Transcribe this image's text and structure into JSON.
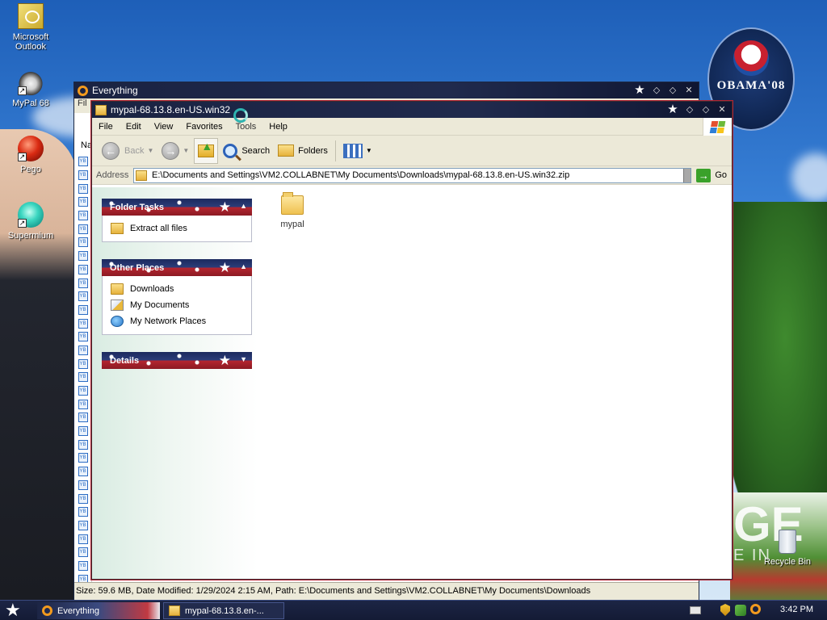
{
  "desktop": {
    "icons": [
      {
        "label": "Microsoft Outlook",
        "icon": "outlook-icon"
      },
      {
        "label": "MyPal 68",
        "icon": "mypal-icon"
      },
      {
        "label": "Pego",
        "icon": "pego-icon"
      },
      {
        "label": "Supermium",
        "icon": "supermium-icon"
      }
    ],
    "recycle_bin": "Recycle Bin",
    "badge_text": "OBAMA'08",
    "wallpaper_text_big": "GE",
    "wallpaper_text_small": "E IN"
  },
  "everything_window": {
    "title": "Everything",
    "side_label": "Na",
    "menu_fragment": "Fil",
    "status_bar": "Size: 59.6 MB, Date Modified: 1/29/2024 2:15 AM, Path: E:\\Documents and Settings\\VM2.COLLABNET\\My Documents\\Downloads"
  },
  "explorer_window": {
    "title": "mypal-68.13.8.en-US.win32",
    "menu": [
      "File",
      "Edit",
      "View",
      "Favorites",
      "Tools",
      "Help"
    ],
    "toolbar": {
      "back": "Back",
      "search": "Search",
      "folders": "Folders"
    },
    "address": {
      "label": "Address",
      "value": "E:\\Documents and Settings\\VM2.COLLABNET\\My Documents\\Downloads\\mypal-68.13.8.en-US.win32.zip",
      "go": "Go"
    },
    "panels": {
      "folder_tasks": {
        "title": "Folder Tasks",
        "items": [
          "Extract all files"
        ]
      },
      "other_places": {
        "title": "Other Places",
        "items": [
          "Downloads",
          "My Documents",
          "My Network Places"
        ]
      },
      "details": {
        "title": "Details"
      }
    },
    "files": [
      {
        "name": "mypal",
        "icon": "folder-icon"
      }
    ]
  },
  "taskbar": {
    "buttons": [
      "Everything",
      "mypal-68.13.8.en-..."
    ],
    "clock": "3:42 PM"
  },
  "colors": {
    "title_bar": "#1a2342",
    "panel_red": "#b52630",
    "panel_blue": "#1c2a5e",
    "taskbar": "#1c2545"
  }
}
